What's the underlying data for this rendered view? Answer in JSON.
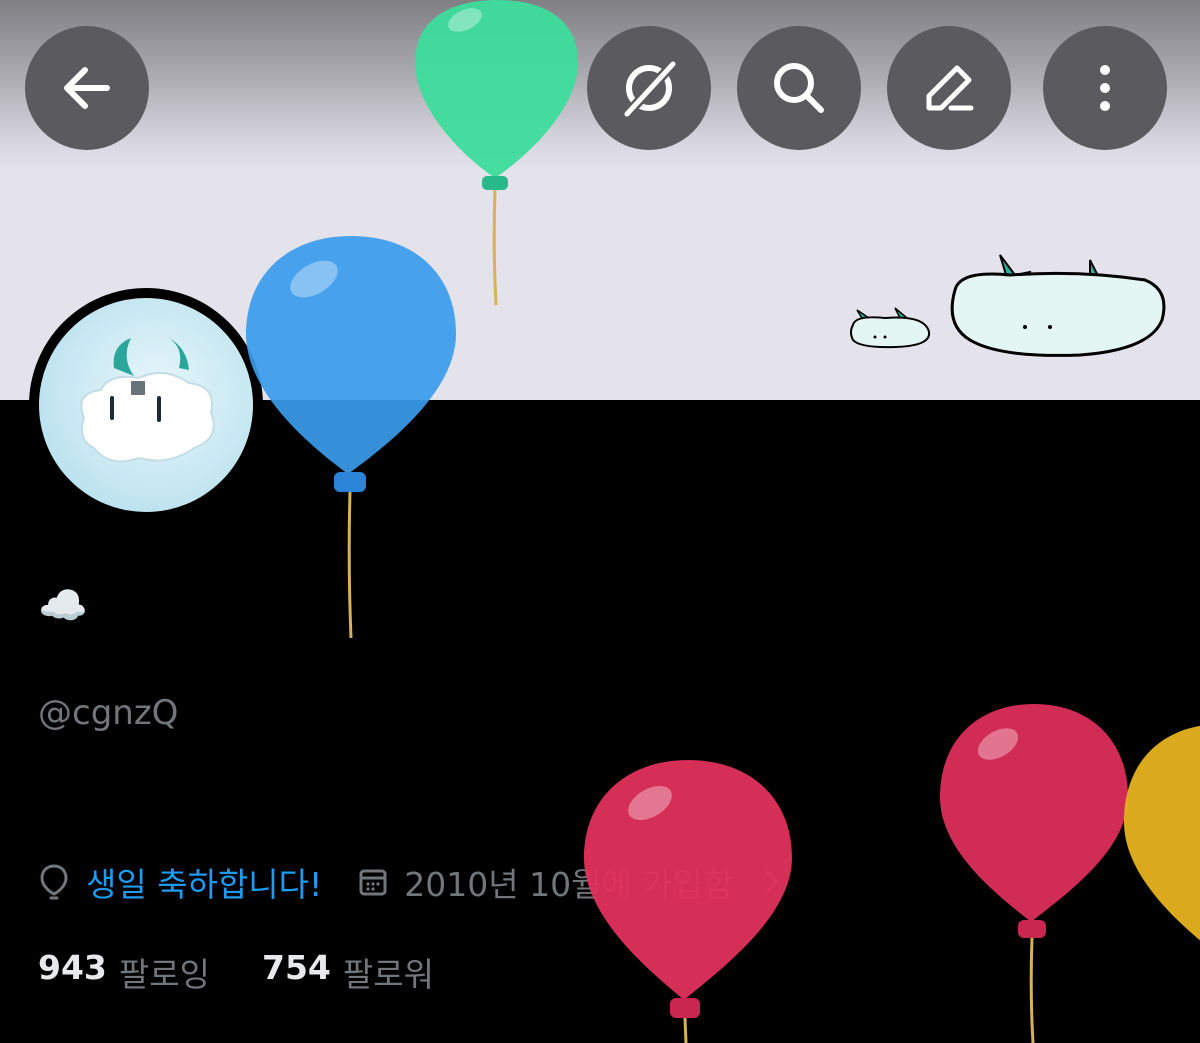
{
  "header": {
    "back_icon": "arrow-left-icon",
    "actions": [
      {
        "icon": "grok-slash-icon"
      },
      {
        "icon": "search-icon"
      },
      {
        "icon": "edit-pencil-icon"
      },
      {
        "icon": "more-vertical-icon"
      }
    ],
    "button_color": "#5b5b5f"
  },
  "profile": {
    "display_name": "☁️",
    "handle": "@cgnzQ",
    "birthday_icon": "balloon-icon",
    "birthday_text": "생일 축하합니다!",
    "joined_icon": "calendar-icon",
    "joined_text": "2010년 10월에 가입함",
    "following_count": "943",
    "following_label": "팔로잉",
    "followers_count": "754",
    "followers_label": "팔로워"
  },
  "colors": {
    "link": "#1d9bf0",
    "muted": "#71767b",
    "background": "#000000",
    "banner": "#e4e2ea"
  },
  "decorations": {
    "balloons": [
      "green",
      "blue",
      "red",
      "red",
      "yellow"
    ]
  }
}
